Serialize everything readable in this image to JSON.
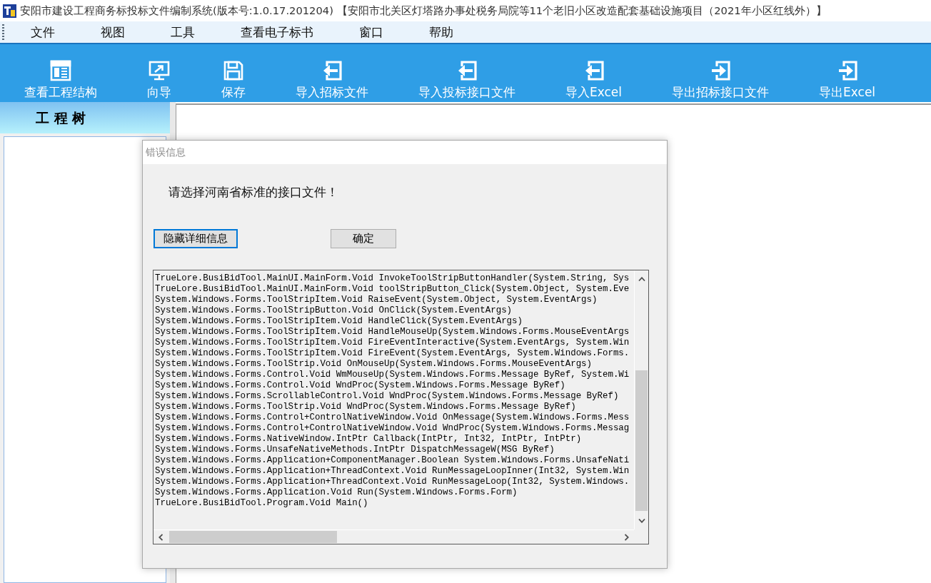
{
  "title_bar": {
    "title": "安阳市建设工程商务标投标文件编制系统(版本号:1.0.17.201204) 【安阳市北关区灯塔路办事处税务局院等11个老旧小区改造配套基础设施项目（2021年小区红线外）】"
  },
  "menu": [
    "文件",
    "视图",
    "工具",
    "查看电子标书",
    "窗口",
    "帮助"
  ],
  "toolbar": [
    {
      "label": "查看工程结构",
      "kind": "structure"
    },
    {
      "label": "向导",
      "kind": "wizard"
    },
    {
      "label": "保存",
      "kind": "save"
    },
    {
      "label": "导入招标文件",
      "kind": "import"
    },
    {
      "label": "导入投标接口文件",
      "kind": "import"
    },
    {
      "label": "导入Excel",
      "kind": "import"
    },
    {
      "label": "导出招标接口文件",
      "kind": "export"
    },
    {
      "label": "导出Excel",
      "kind": "export"
    }
  ],
  "project_tree": {
    "title": "工 程 树"
  },
  "dialog": {
    "title": "错误信息",
    "message": "请选择河南省标准的接口文件！",
    "buttons": [
      {
        "label": "隐藏详细信息",
        "focused": true
      },
      {
        "label": "确定",
        "focused": false
      }
    ],
    "details": [
      "TrueLore.BusiBidTool.MainUI.MainForm.Void InvokeToolStripButtonHandler(System.String, Sys",
      "TrueLore.BusiBidTool.MainUI.MainForm.Void toolStripButton_Click(System.Object, System.Eve",
      "System.Windows.Forms.ToolStripItem.Void RaiseEvent(System.Object, System.EventArgs)",
      "System.Windows.Forms.ToolStripButton.Void OnClick(System.EventArgs)",
      "System.Windows.Forms.ToolStripItem.Void HandleClick(System.EventArgs)",
      "System.Windows.Forms.ToolStripItem.Void HandleMouseUp(System.Windows.Forms.MouseEventArgs",
      "System.Windows.Forms.ToolStripItem.Void FireEventInteractive(System.EventArgs, System.Win",
      "System.Windows.Forms.ToolStripItem.Void FireEvent(System.EventArgs, System.Windows.Forms.",
      "System.Windows.Forms.ToolStrip.Void OnMouseUp(System.Windows.Forms.MouseEventArgs)",
      "System.Windows.Forms.Control.Void WmMouseUp(System.Windows.Forms.Message ByRef, System.Wi",
      "System.Windows.Forms.Control.Void WndProc(System.Windows.Forms.Message ByRef)",
      "System.Windows.Forms.ScrollableControl.Void WndProc(System.Windows.Forms.Message ByRef)",
      "System.Windows.Forms.ToolStrip.Void WndProc(System.Windows.Forms.Message ByRef)",
      "System.Windows.Forms.Control+ControlNativeWindow.Void OnMessage(System.Windows.Forms.Mess",
      "System.Windows.Forms.Control+ControlNativeWindow.Void WndProc(System.Windows.Forms.Messag",
      "System.Windows.Forms.NativeWindow.IntPtr Callback(IntPtr, Int32, IntPtr, IntPtr)",
      "System.Windows.Forms.UnsafeNativeMethods.IntPtr DispatchMessageW(MSG ByRef)",
      "System.Windows.Forms.Application+ComponentManager.Boolean System.Windows.Forms.UnsafeNati",
      "System.Windows.Forms.Application+ThreadContext.Void RunMessageLoopInner(Int32, System.Win",
      "System.Windows.Forms.Application+ThreadContext.Void RunMessageLoop(Int32, System.Windows.",
      "System.Windows.Forms.Application.Void Run(System.Windows.Forms.Form)",
      "TrueLore.BusiBidTool.Program.Void Main()"
    ]
  }
}
